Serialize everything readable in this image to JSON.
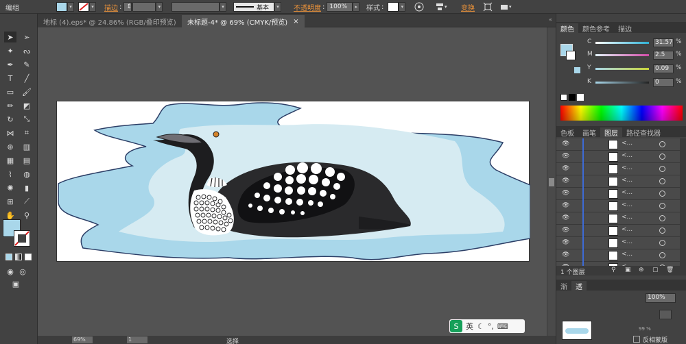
{
  "app": {
    "mode_label": "编组"
  },
  "control_bar": {
    "stroke_label": "描边",
    "brush_label": "基本",
    "opacity_label": "不透明度",
    "opacity_value": "100%",
    "style_label": "样式",
    "transform_label": "变换",
    "fill_color": "#a9d7ea"
  },
  "tabs": [
    {
      "label": "地标 (4).eps* @ 24.86% (RGB/叠印预览)",
      "close": "×"
    },
    {
      "label": "未标题-4* @ 69% (CMYK/预览)",
      "close": "×"
    }
  ],
  "color_panel": {
    "tabs": [
      "颜色",
      "颜色参考",
      "描边"
    ],
    "sliders": [
      {
        "label": "C",
        "value": "31.57",
        "color": "#2fb3d7"
      },
      {
        "label": "M",
        "value": "2.5",
        "color": "#d24ca8"
      },
      {
        "label": "Y",
        "value": "0.09",
        "color": "#c9d63a"
      },
      {
        "label": "K",
        "value": "0",
        "color": "#222222"
      }
    ],
    "percent": "%"
  },
  "layers_panel": {
    "tabs": [
      "色板",
      "画笔",
      "图层",
      "路径查找器"
    ],
    "row_count": 11,
    "row_label": "<...",
    "footer_label": "1 个图层"
  },
  "bottom_panel": {
    "tabs": [
      "渐",
      "透"
    ],
    "opacity_value": "100%",
    "mask_label": "反相蒙版",
    "clip_label": "99 %"
  },
  "status_bar": {
    "zoom": "69%",
    "page": "1",
    "tool": "选择"
  },
  "ime": {
    "label": "英"
  }
}
